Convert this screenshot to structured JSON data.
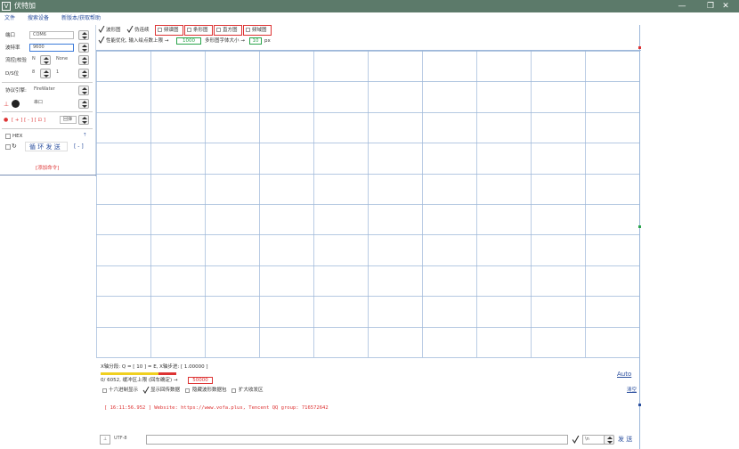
{
  "window": {
    "title": "伏特加",
    "logo_glyph": "V",
    "minimize_glyph": "—",
    "maximize_glyph": "❐",
    "close_glyph": "✕"
  },
  "menu": {
    "items": [
      "文件",
      "搜索设备",
      "新版本/获取帮助"
    ]
  },
  "left": {
    "port_label": "端口",
    "port_value": "COM6",
    "baud_label": "波特率",
    "baud_value": "9600",
    "flow_label": "流控|校验",
    "flow_value": "N",
    "parity_value": "None",
    "bits_label": "D/S位",
    "data_bits": "8",
    "stop_bits": "1",
    "engine_label": "协议引擎:",
    "engine_value": "FireWater",
    "port_close_label": "串口",
    "cmd_label": "[ + ] [ - ] [ ⊡ ]",
    "cmd_mode": "回弹",
    "hex_label": "HEX",
    "loop_send_label": "循 环 发 送",
    "bracket_label": "[ - ]",
    "add_cmd_label": "[添加命令]",
    "pin_glyph": "⇡",
    "anchor_glyph": "⊥",
    "record_glyph": "●",
    "loop_glyph": "↻",
    "arrow_glyph": "↑"
  },
  "top": {
    "waveform_label": "波形图",
    "tick_glyph": "✓",
    "smooth_label": "伪连续",
    "modes": [
      "频谱图",
      "条形图",
      "直方图",
      "频域图"
    ],
    "perf_label": "性能优化, 输入绘点数上限 →",
    "points_value": "1000",
    "font_label": "多形图字体大小 →",
    "font_value": "10",
    "px_label": "px"
  },
  "chart": {
    "columns": 10,
    "rows": 10,
    "grid_color": "#9cb7d9",
    "accent_red": "#d33333",
    "accent_green": "#2aa44a"
  },
  "controls": {
    "xaxis_line": "X轴分段: Q = [ 10 ] = E, X轴步进: [ 1.00000 ]",
    "buffer_line": "0/ 6052, 缓冲区上限 (回车确定) →",
    "buffer_value": "50000",
    "auto_label": "Auto",
    "hex_display": "十六进制显示",
    "show_rx": "显示回传数据",
    "hide_wave": "隐藏波形数据包",
    "expand_rx": "扩大收发区",
    "clear_label": "清空"
  },
  "console": {
    "line": "[ 16:11:56.952 ] Website: https://www.vofa.plus, Tencent QQ group: 716572642"
  },
  "sendbar": {
    "anchor_glyph": "⊥",
    "encoding": "UTF-8",
    "line_end": "\\n",
    "send_label": "发 送"
  }
}
